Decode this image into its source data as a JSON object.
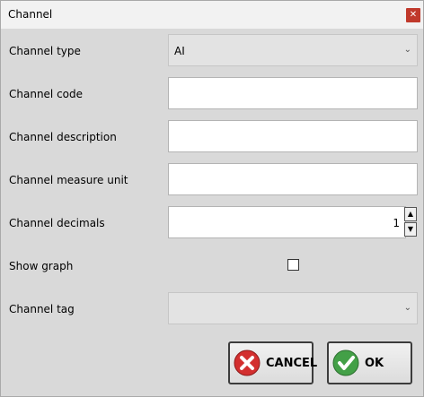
{
  "window": {
    "title": "Channel"
  },
  "fields": {
    "channel_type": {
      "label": "Channel type",
      "value": "AI"
    },
    "channel_code": {
      "label": "Channel code",
      "value": ""
    },
    "channel_description": {
      "label": "Channel description",
      "value": ""
    },
    "channel_measure_unit": {
      "label": "Channel measure unit",
      "value": ""
    },
    "channel_decimals": {
      "label": "Channel decimals",
      "value": "1"
    },
    "show_graph": {
      "label": "Show graph",
      "checked": false
    },
    "channel_tag": {
      "label": "Channel tag",
      "value": ""
    }
  },
  "buttons": {
    "cancel": {
      "label": "CANCEL",
      "icon": "cancel-x-icon",
      "color": "#d32f2f"
    },
    "ok": {
      "label": "OK",
      "icon": "check-icon",
      "color": "#43a047"
    }
  }
}
